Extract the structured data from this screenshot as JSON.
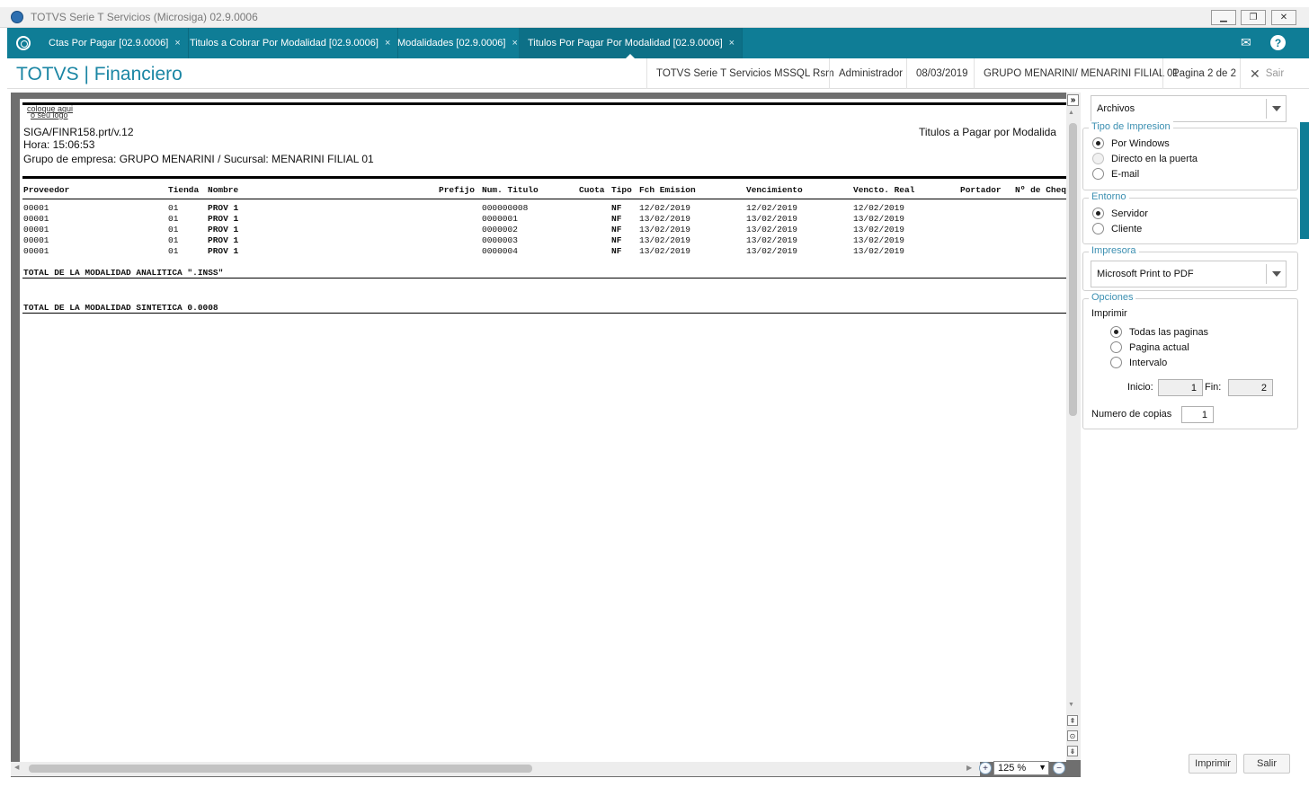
{
  "window": {
    "title": "TOTVS Serie T Servicios (Microsiga) 02.9.0006",
    "minimize_symbol": "▁",
    "restore_symbol": "❐",
    "close_symbol": "✕"
  },
  "tabs": [
    {
      "label": "Ctas Por Pagar [02.9.0006]",
      "close": "×"
    },
    {
      "label": "Titulos a Cobrar Por Modalidad [02.9.0006]",
      "close": "×"
    },
    {
      "label": "Modalidades [02.9.0006]",
      "close": "×"
    },
    {
      "label": "Titulos Por Pagar Por Modalidad [02.9.0006]",
      "close": "×",
      "active": true
    }
  ],
  "topbar_icons": {
    "mail": "✉",
    "help": "?"
  },
  "header": {
    "app_title": "TOTVS | Financiero",
    "environment": "TOTVS Serie T Servicios MSSQL Rsm",
    "user": "Administrador",
    "date": "08/03/2019",
    "company": "GRUPO MENARINI/ MENARINI FILIAL 01",
    "page": "Pagina 2 de 2",
    "close_symbol": "✕",
    "exit_label": "Sair"
  },
  "report": {
    "logo_text_line1": "coloque aqui",
    "logo_text_line2": "o seu logo",
    "program": "SIGA/FINR158.prt/v.12",
    "time": "Hora: 15:06:53",
    "title": "Titulos a Pagar por Modalida",
    "group": "Grupo de empresa: GRUPO MENARINI / Sucursal: MENARINI FILIAL 01",
    "columns": [
      "Proveedor",
      "Tienda",
      "Nombre",
      "Prefijo",
      "Num. Titulo",
      "Cuota",
      "Tipo",
      "Fch Emision",
      "Vencimiento",
      "Vencto. Real",
      "Portador",
      "Nº de Cheq"
    ],
    "rows": [
      {
        "proveedor": "00001",
        "tienda": "01",
        "nombre": "PROV 1",
        "num": "000000008",
        "tipo": "NF",
        "emision": "12/02/2019",
        "venc": "12/02/2019",
        "real": "12/02/2019"
      },
      {
        "proveedor": "00001",
        "tienda": "01",
        "nombre": "PROV 1",
        "num": "0000001",
        "tipo": "NF",
        "emision": "13/02/2019",
        "venc": "13/02/2019",
        "real": "13/02/2019"
      },
      {
        "proveedor": "00001",
        "tienda": "01",
        "nombre": "PROV 1",
        "num": "0000002",
        "tipo": "NF",
        "emision": "13/02/2019",
        "venc": "13/02/2019",
        "real": "13/02/2019"
      },
      {
        "proveedor": "00001",
        "tienda": "01",
        "nombre": "PROV 1",
        "num": "0000003",
        "tipo": "NF",
        "emision": "13/02/2019",
        "venc": "13/02/2019",
        "real": "13/02/2019"
      },
      {
        "proveedor": "00001",
        "tienda": "01",
        "nombre": "PROV 1",
        "num": "0000004",
        "tipo": "NF",
        "emision": "13/02/2019",
        "venc": "13/02/2019",
        "real": "13/02/2019"
      }
    ],
    "total_analitica": "TOTAL DE LA MODALIDAD ANALITICA \".INSS\"",
    "total_sintetica": "TOTAL DE LA MODALIDAD SINTETICA 0.0008"
  },
  "viewer": {
    "zoom": "125 %",
    "scroll_up": "▲",
    "scroll_down": "▼",
    "scroll_left": "◀",
    "scroll_right": "▶",
    "expand": "»",
    "nav_top": "⇞",
    "nav_mid": "⊙",
    "nav_bottom": "⇟",
    "zoom_in": "+",
    "zoom_out": "−",
    "dropdown": "▼"
  },
  "panel": {
    "output": "Archivos",
    "print_type": {
      "title": "Tipo de Impresion",
      "options": [
        "Por Windows",
        "Directo en la puerta",
        "E-mail"
      ]
    },
    "environment": {
      "title": "Entorno",
      "options": [
        "Servidor",
        "Cliente"
      ]
    },
    "printer": {
      "title": "Impresora",
      "value": "Microsoft Print to PDF"
    },
    "options": {
      "title": "Opciones",
      "print_label": "Imprimir",
      "choices": [
        "Todas las paginas",
        "Pagina actual",
        "Intervalo"
      ],
      "start_label": "Inicio:",
      "start_value": "1",
      "end_label": "Fin:",
      "end_value": "2",
      "copies_label": "Numero de copias",
      "copies_value": "1"
    },
    "print_button": "Imprimir",
    "exit_button": "Salir"
  },
  "colors": {
    "accent": "#0f7d96",
    "title_text": "#1b86a4",
    "group_title": "#3b8fb1"
  }
}
